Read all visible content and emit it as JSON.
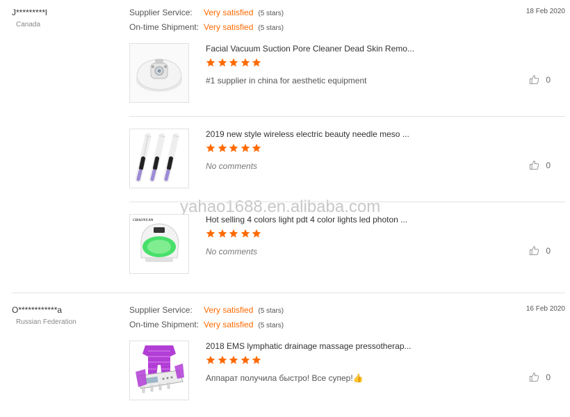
{
  "watermark": "yahao1688.en.alibaba.com",
  "labels": {
    "supplier_service": "Supplier Service:",
    "ontime_shipment": "On-time Shipment:"
  },
  "reviews": [
    {
      "buyer": "J*********l",
      "country": "Canada",
      "date": "18 Feb 2020",
      "supplier_service": "Very satisfied",
      "supplier_service_stars": "(5 stars)",
      "ontime_shipment": "Very satisfied",
      "ontime_shipment_stars": "(5 stars)",
      "products": [
        {
          "title": "Facial Vacuum Suction Pore Cleaner Dead Skin Remo...",
          "rating": 5,
          "comment": "#1 supplier in china for aesthetic equipment",
          "likes": "0",
          "thumb_icon": "facial-vacuum-device"
        },
        {
          "title": "2019 new style wireless electric beauty needle meso ...",
          "rating": 5,
          "comment": "No comments",
          "likes": "0",
          "thumb_icon": "derma-pens"
        },
        {
          "title": "Hot selling 4 colors light pdt 4 color lights led photon ...",
          "rating": 5,
          "comment": "No comments",
          "likes": "0",
          "thumb_icon": "led-mask-device",
          "thumb_brand": "CHAOYUAN"
        }
      ]
    },
    {
      "buyer": "O************a",
      "country": "Russian Federation",
      "date": "16 Feb 2020",
      "supplier_service": "Very satisfied",
      "supplier_service_stars": "(5 stars)",
      "ontime_shipment": "Very satisfied",
      "ontime_shipment_stars": "(5 stars)",
      "products": [
        {
          "title": "2018 EMS lymphatic drainage massage pressotherap...",
          "rating": 5,
          "comment": "Аппарат получила быстро! Все супер!👍",
          "likes": "0",
          "thumb_icon": "pressotherapy-suit"
        }
      ]
    }
  ],
  "colors": {
    "accent": "#ff6a00",
    "separator": "#e3e3e3"
  }
}
